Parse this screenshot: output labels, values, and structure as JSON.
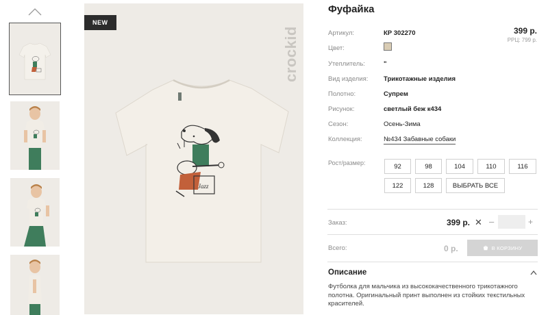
{
  "badge": "NEW",
  "brand_logo": "crockid",
  "product": {
    "title": "Фуфайка",
    "price": "399 р.",
    "rrp": "РРЦ: 799 р."
  },
  "specs": [
    {
      "label": "Артикул:",
      "value": "КР 302270"
    },
    {
      "label": "Цвет:",
      "value": "",
      "swatch_color": "#d9ccb4"
    },
    {
      "label": "Утеплитель:",
      "value": "\""
    },
    {
      "label": "Вид изделия:",
      "value": "Трикотажные изделия"
    },
    {
      "label": "Полотно:",
      "value": "Супрем"
    },
    {
      "label": "Рисунок:",
      "value": "светлый беж к434"
    },
    {
      "label": "Сезон:",
      "value": "Осень-Зима"
    },
    {
      "label": "Коллекция:",
      "value": "№434 Забавные собаки"
    }
  ],
  "sizes": {
    "label": "Рост/размер:",
    "options": [
      "92",
      "98",
      "104",
      "110",
      "116",
      "122",
      "128"
    ],
    "select_all": "ВЫБРАТЬ ВСЕ"
  },
  "order": {
    "label": "Заказ:",
    "price": "399 р.",
    "remove_symbol": "✕",
    "minus_symbol": "–",
    "plus_symbol": "+",
    "quantity": ""
  },
  "total": {
    "label": "Всего:",
    "value": "0 р.",
    "cart_button": "В КОРЗИНУ"
  },
  "description": {
    "title": "Описание",
    "text": "Футболка для мальчика из высококачественного трикотажного полотна. Оригинальный принт выполнен из стойких текстильных красителей."
  },
  "colors": {
    "tee": "#efebe4",
    "background": "#eeebe6",
    "accent_dark": "#2c2c2c",
    "cart_button": "#d4d4d4",
    "print_green": "#3f7d5c",
    "print_orange": "#c2603a"
  },
  "icons": [
    "chevron-up-icon",
    "close-icon",
    "cart-icon",
    "chevron-up-icon"
  ]
}
